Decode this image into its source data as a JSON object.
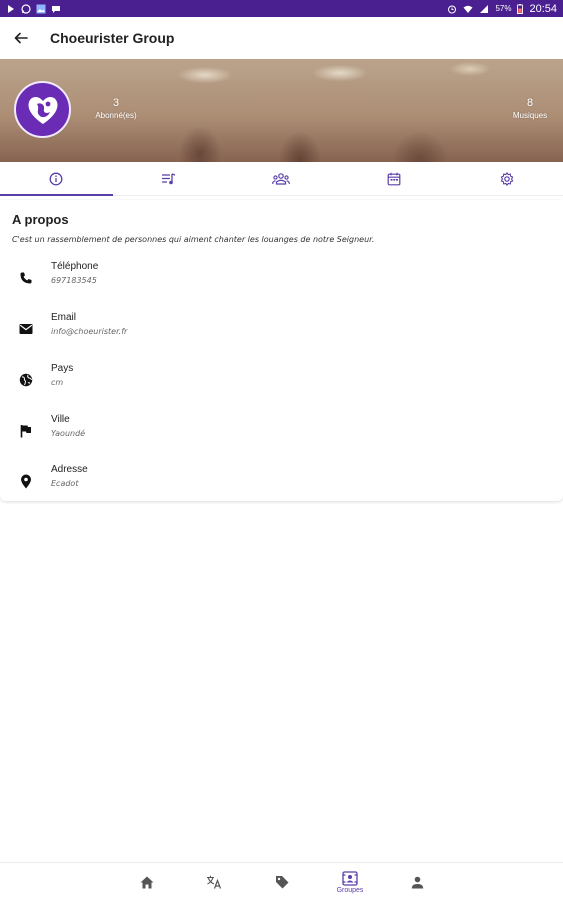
{
  "status_bar": {
    "time": "20:54",
    "battery": "57%",
    "left_icons": [
      "play-icon",
      "whatsapp-icon",
      "gallery-icon",
      "chat-icon"
    ],
    "right_icons": [
      "alarm-icon",
      "wifi-icon",
      "signal-icon",
      "battery-icon"
    ]
  },
  "app_bar": {
    "title": "Choeurister Group"
  },
  "header": {
    "followers_count": "3",
    "followers_label": "Abonné(es)",
    "musics_count": "8",
    "musics_label": "Musiques"
  },
  "tabs": [
    {
      "name": "info",
      "icon": "info-icon",
      "active": true
    },
    {
      "name": "playlist",
      "icon": "playlist-icon",
      "active": false
    },
    {
      "name": "members",
      "icon": "group-icon",
      "active": false
    },
    {
      "name": "calendar",
      "icon": "calendar-icon",
      "active": false
    },
    {
      "name": "settings",
      "icon": "gear-icon",
      "active": false
    }
  ],
  "about": {
    "title": "A propos",
    "description": "C'est un rassemblement de personnes qui aiment chanter les louanges de notre Seigneur.",
    "items": [
      {
        "icon": "phone-icon",
        "label": "Téléphone",
        "value": "697183545"
      },
      {
        "icon": "email-icon",
        "label": "Email",
        "value": "info@choeurister.fr"
      },
      {
        "icon": "globe-icon",
        "label": "Pays",
        "value": "cm"
      },
      {
        "icon": "flag-icon",
        "label": "Ville",
        "value": "Yaoundé"
      },
      {
        "icon": "location-pin-icon",
        "label": "Adresse",
        "value": "Ecadot"
      }
    ]
  },
  "bottom_nav": {
    "items": [
      {
        "icon": "home-icon",
        "label": ""
      },
      {
        "icon": "translate-icon",
        "label": ""
      },
      {
        "icon": "tag-icon",
        "label": ""
      },
      {
        "icon": "groups-icon",
        "label": "Groupes",
        "active": true
      },
      {
        "icon": "person-icon",
        "label": ""
      }
    ]
  },
  "colors": {
    "status_bar": "#4a1f8f",
    "accent": "#5b3fa8",
    "avatar_bg": "#6a2bb5"
  }
}
